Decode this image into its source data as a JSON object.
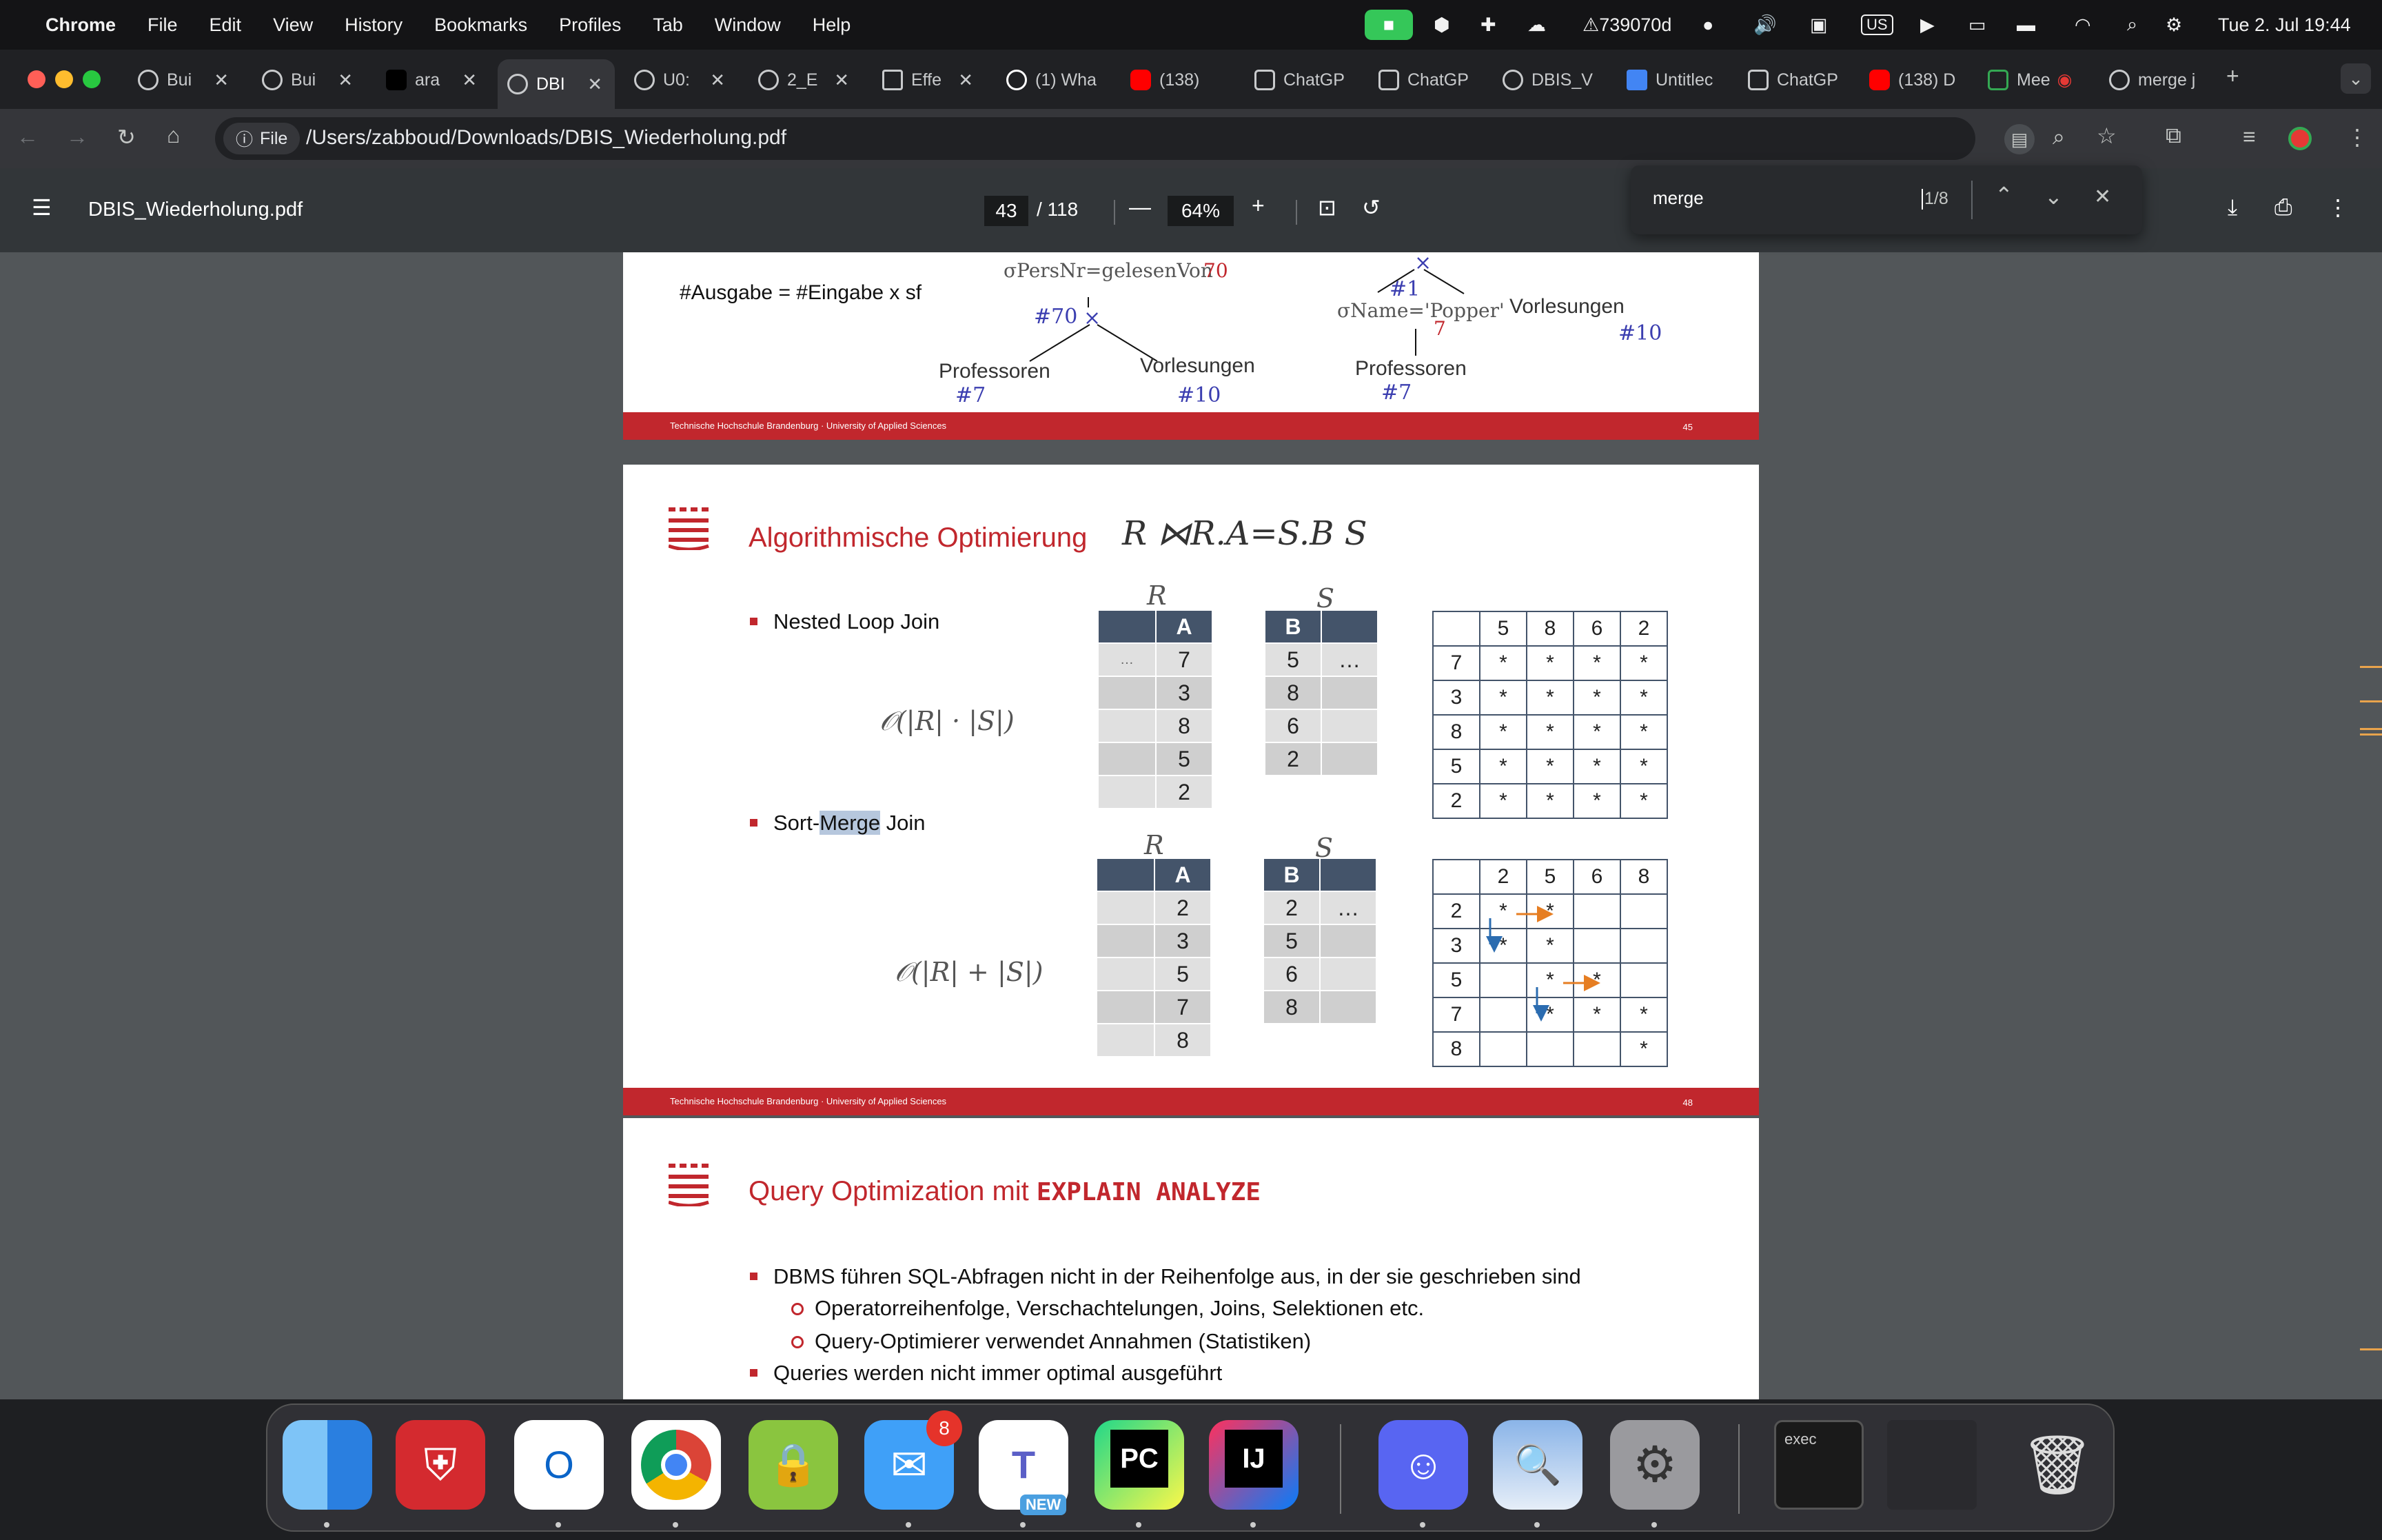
{
  "menubar": {
    "app": "Chrome",
    "items": [
      "File",
      "Edit",
      "View",
      "History",
      "Bookmarks",
      "Profiles",
      "Tab",
      "Window",
      "Help"
    ],
    "status": {
      "dropbox_count": "739070d",
      "keyboard": "US",
      "datetime": "Tue 2. Jul  19:44"
    }
  },
  "tabs": [
    {
      "label": "Bui",
      "icon": "globe-icon"
    },
    {
      "label": "Bui",
      "icon": "globe-icon"
    },
    {
      "label": "ara",
      "icon": "black-square-icon"
    },
    {
      "label": "DBI",
      "icon": "globe-icon",
      "active": true
    },
    {
      "label": "U0:",
      "icon": "globe-icon"
    },
    {
      "label": "2_E",
      "icon": "globe-icon"
    },
    {
      "label": "Effe",
      "icon": "doc-icon"
    },
    {
      "label": "(1) Wha",
      "icon": "whatsapp-icon"
    },
    {
      "label": "(138)",
      "icon": "youtube-icon"
    },
    {
      "label": "ChatGP",
      "icon": "chatgpt-icon"
    },
    {
      "label": "ChatGP",
      "icon": "chatgpt-icon"
    },
    {
      "label": "DBIS_V",
      "icon": "globe-icon"
    },
    {
      "label": "Untitlec",
      "icon": "docs-icon"
    },
    {
      "label": "ChatGP",
      "icon": "chatgpt-icon"
    },
    {
      "label": "(138) D",
      "icon": "youtube-icon"
    },
    {
      "label": "Mee",
      "icon": "meet-icon"
    },
    {
      "label": "merge j",
      "icon": "globe-icon"
    }
  ],
  "toolbar": {
    "file_chip": "File",
    "url": "/Users/zabboud/Downloads/DBIS_Wiederholung.pdf"
  },
  "pdf": {
    "filename": "DBIS_Wiederholung.pdf",
    "page": "43",
    "total": "/ 118",
    "zoom": "64%"
  },
  "find": {
    "query": "merge",
    "count": "1/8"
  },
  "slide45": {
    "formula": "#Ausgabe = #Eingabe x sf",
    "sigma1": "σPersNr=gelesenVon",
    "sigma1_sf": "70",
    "n70": "#70",
    "prof": "Professoren",
    "n7a": "#7",
    "vorl": "Vorlesungen",
    "n10a": "#10",
    "n1": "#1",
    "sigma2": "σName='Popper'",
    "sigma2_sf": "7",
    "prof2": "Professoren",
    "n7b": "#7",
    "vorl2": "Vorlesungen",
    "n10b": "#10",
    "footer": "Technische Hochschule Brandenburg · University of Applied Sciences",
    "pagenum": "45"
  },
  "slide48": {
    "title": "Algorithmische Optimierung",
    "title_math": "R ⋈R.A=S.B S",
    "nlj": "Nested Loop Join",
    "nlj_complexity": "𝒪(|R| · |S|)",
    "smj_pre": "Sort-",
    "smj_hl": "Merge",
    "smj_post": " Join",
    "smj_complexity": "𝒪(|R| + |S|)",
    "R": "R",
    "S": "S",
    "colA": "A",
    "colB": "B",
    "ellipsis": "…",
    "nlj_R": [
      "7",
      "3",
      "8",
      "5",
      "2"
    ],
    "nlj_S": [
      "5",
      "8",
      "6",
      "2"
    ],
    "nlj_matrix_cols": [
      "5",
      "8",
      "6",
      "2"
    ],
    "nlj_matrix_rows": [
      "7",
      "3",
      "8",
      "5",
      "2"
    ],
    "smj_R": [
      "2",
      "3",
      "5",
      "7",
      "8"
    ],
    "smj_S": [
      "2",
      "5",
      "6",
      "8"
    ],
    "smj_matrix_cols": [
      "2",
      "5",
      "6",
      "8"
    ],
    "smj_matrix_rows": [
      "2",
      "3",
      "5",
      "7",
      "8"
    ],
    "star": "*",
    "footer": "Technische Hochschule Brandenburg · University of Applied Sciences",
    "pagenum": "48"
  },
  "slide49": {
    "title": "Query Optimization mit ",
    "title_code": "EXPLAIN ANALYZE",
    "b1": "DBMS führen SQL-Abfragen nicht in der Reihenfolge aus, in der sie geschrieben sind",
    "s1": "Operatorreihenfolge, Verschachtelungen, Joins, Selektionen etc.",
    "s2": "Query-Optimierer verwendet Annahmen (Statistiken)",
    "b2": "Queries werden nicht immer optimal ausgeführt"
  },
  "dock": {
    "apps": [
      "Finder",
      "FortiClient",
      "Outlook",
      "Chrome",
      "Password Manager",
      "Mail",
      "Teams",
      "PyCharm",
      "IntelliJ IDEA",
      "Discord",
      "Preview",
      "System Settings",
      "Terminal",
      "Screenshot",
      "Trash"
    ],
    "mail_badge": "8",
    "teams_badge": "NEW",
    "terminal_label": "exec"
  },
  "colors": {
    "accent_red": "#c1272d",
    "table_header": "#44546a",
    "math_blue": "#3b3eb0"
  }
}
